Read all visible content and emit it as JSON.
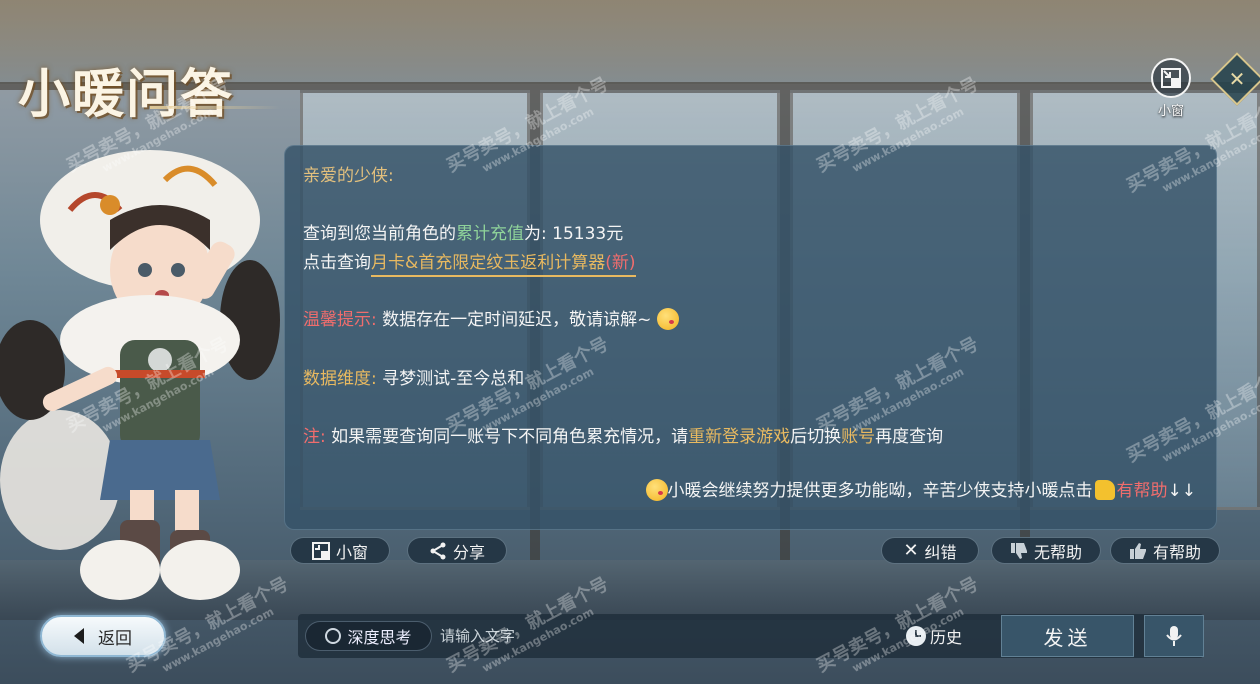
{
  "title": "小暖问答",
  "top_right": {
    "mini_window_label": "小窗"
  },
  "panel": {
    "greeting": "亲爱的少侠:",
    "line1": {
      "prefix": "查询到您当前角色的",
      "highlight": "累计充值",
      "suffix": "为: 15133元"
    },
    "line2": {
      "prefix": "点击查询",
      "link": "月卡&首充限定纹玉返利计算器",
      "tag": "(新)"
    },
    "tip": {
      "label": "温馨提示:",
      "text": "数据存在一定时间延迟，敬请谅解~"
    },
    "dimension": {
      "label": "数据维度:",
      "text": "寻梦测试-至今总和"
    },
    "note": {
      "label": "注:",
      "text1": "如果需要查询同一账号下不同角色累充情况，请",
      "highlight1": "重新登录游戏",
      "text2": "后切换",
      "highlight2": "账号",
      "text3": "再度查询"
    },
    "footer": {
      "text": "小暖会继续努力提供更多功能呦，辛苦少侠支持小暖点击",
      "highlight": "有帮助",
      "arrows": "↓↓"
    }
  },
  "actions": {
    "mini_window": "小窗",
    "share": "分享",
    "report_error": "纠错",
    "not_helpful": "无帮助",
    "helpful": "有帮助"
  },
  "bottom": {
    "back": "返回",
    "deep_think": "深度思考",
    "input_placeholder": "请输入文字",
    "history": "历史",
    "send": "发送"
  },
  "watermark": {
    "line1": "买号卖号，就上看个号",
    "line2": "www.kangehao.com"
  },
  "colors": {
    "panel_bg": "#345268",
    "gold": "#e8b960",
    "green": "#8fd39a",
    "red": "#f06d6d"
  }
}
